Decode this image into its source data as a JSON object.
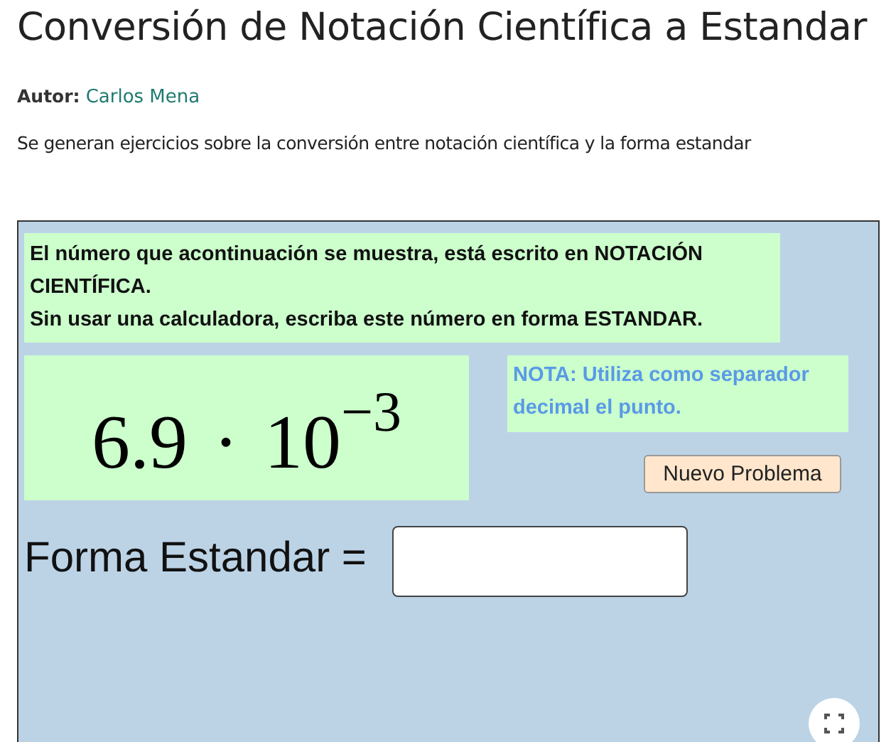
{
  "title": "Conversión de Notación Científica a Estandar",
  "author": {
    "label": "Autor:",
    "name": "Carlos Mena"
  },
  "description": "Se generan ejercicios sobre la conversión entre notación científica y la forma estandar",
  "applet": {
    "instructions": [
      "El número que acontinuación se muestra, está escrito en NOTACIÓN CIENTÍFICA.",
      "Sin usar una calculadora, escriba este número en forma ESTANDAR."
    ],
    "number": {
      "mantissa": "6.9",
      "operator": "·",
      "base": "10",
      "exponent": "−3"
    },
    "note": "NOTA: Utiliza como separador decimal el punto.",
    "button": "Nuevo Problema",
    "answer_label": "Forma Estandar ="
  }
}
